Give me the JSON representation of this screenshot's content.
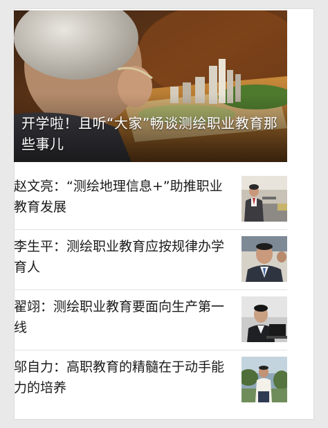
{
  "hero": {
    "title": "开学啦！且听“大家”畅谈测绘职业教育那些事儿"
  },
  "articles": [
    {
      "title": "赵文亮：“测绘地理信息+”助推职业教育发展",
      "thumb_icon": "photo-speaker-at-podium"
    },
    {
      "title": "李生平：测绘职业教育应按规律办学育人",
      "thumb_icon": "photo-man-in-suit"
    },
    {
      "title": "翟翊：测绘职业教育要面向生产第一线",
      "thumb_icon": "photo-man-at-laptop"
    },
    {
      "title": "邬自力：高职教育的精髓在于动手能力的培养",
      "thumb_icon": "photo-man-outdoors"
    }
  ],
  "colors": {
    "page_bg": "#e9e9e9",
    "card_bg": "#ffffff",
    "text": "#1a1a1a",
    "divider": "#e2e2e2"
  }
}
